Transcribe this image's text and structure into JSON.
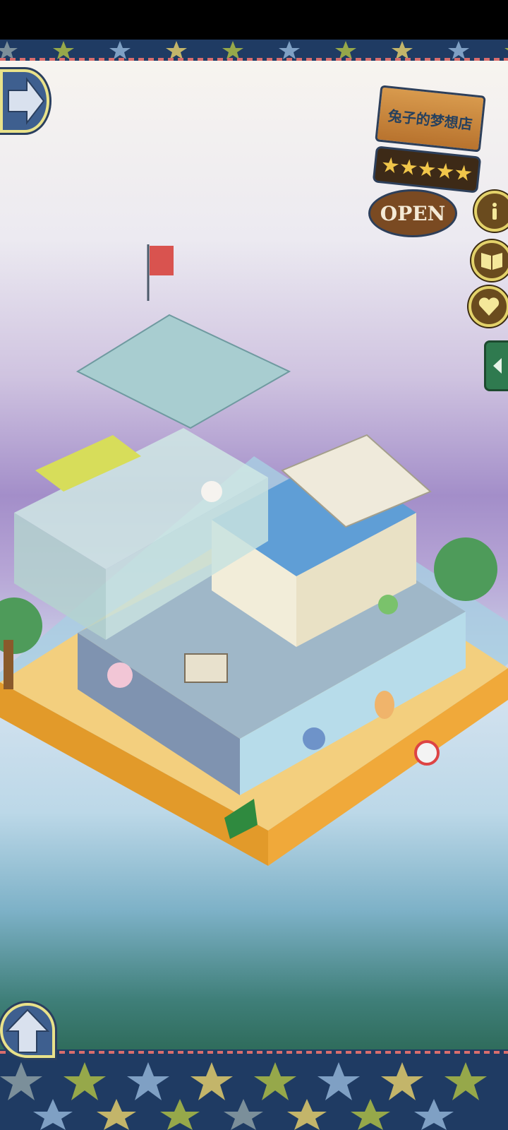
{
  "shop": {
    "name": "兔子的梦想店",
    "rating_stars": 5,
    "status": "OPEN"
  },
  "buttons": {
    "nav_right": "arrow-right-icon",
    "nav_up": "arrow-up-icon",
    "info": "info-icon",
    "book": "book-icon",
    "heart": "heart-icon",
    "side_tab": "chevron-left-icon"
  },
  "colors": {
    "frame": "#1f3b63",
    "wood": "#b8732e",
    "gold": "#e3d26a"
  }
}
